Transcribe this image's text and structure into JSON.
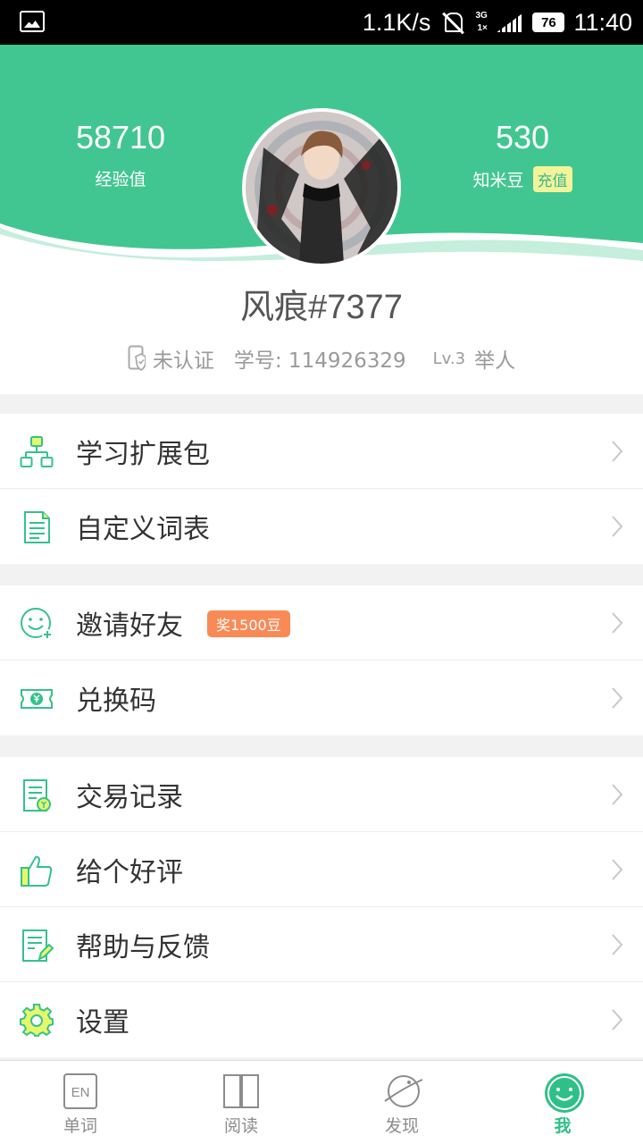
{
  "status_bar": {
    "net_speed": "1.1K/s",
    "signal_top": "3G",
    "signal_bottom": "1×",
    "battery": "76",
    "time": "11:40"
  },
  "header": {
    "experience_value": "58710",
    "experience_label": "经验值",
    "beans_value": "530",
    "beans_label": "知米豆",
    "recharge_label": "充值"
  },
  "profile": {
    "name": "风痕#7377",
    "verify_status": "未认证",
    "student_id": "学号: 114926329",
    "level": "Lv.3",
    "level_title": "举人"
  },
  "menu_groups": [
    [
      {
        "label": "学习扩展包",
        "icon": "network-icon"
      },
      {
        "label": "自定义词表",
        "icon": "document-icon"
      }
    ],
    [
      {
        "label": "邀请好友",
        "icon": "smile-plus-icon",
        "badge": "奖1500豆"
      },
      {
        "label": "兑换码",
        "icon": "ticket-icon"
      }
    ],
    [
      {
        "label": "交易记录",
        "icon": "receipt-icon"
      },
      {
        "label": "给个好评",
        "icon": "thumbs-up-icon"
      },
      {
        "label": "帮助与反馈",
        "icon": "edit-note-icon"
      },
      {
        "label": "设置",
        "icon": "gear-icon"
      }
    ]
  ],
  "bottom_nav": {
    "tabs": [
      {
        "label": "单词",
        "icon_text": "EN"
      },
      {
        "label": "阅读"
      },
      {
        "label": "发现"
      },
      {
        "label": "我"
      }
    ],
    "active_index": 3
  },
  "colors": {
    "primary": "#42c691",
    "icon_green": "#34c28c",
    "badge": "#f98a55",
    "recharge_bg": "#f3f39a"
  }
}
